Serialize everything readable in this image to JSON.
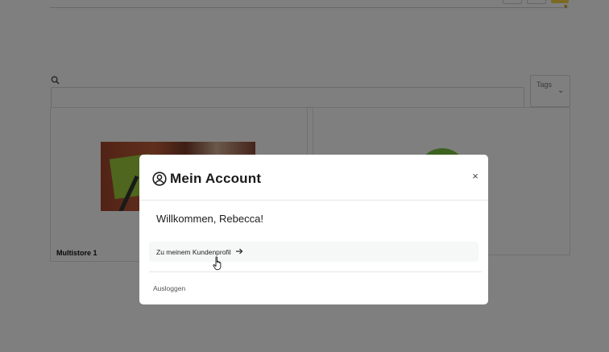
{
  "background": {
    "tags_label": "Tags",
    "cards": [
      {
        "title": "Multistore 1"
      },
      {
        "title": ""
      }
    ]
  },
  "modal": {
    "title": "Mein Account",
    "close_label": "×",
    "welcome": "Willkommen, Rebecca!",
    "profile_link_label": "Zu meinem Kundenprofil",
    "logout_label": "Ausloggen"
  },
  "icons": {
    "account": "user-circle-icon",
    "close": "close-icon",
    "arrow": "arrow-right-icon",
    "search": "search-icon",
    "cursor": "hand-pointer-icon"
  },
  "colors": {
    "overlay": "rgba(0,0,0,0.5)",
    "modal_bg": "#ffffff",
    "accent_yellow": "#f5d547",
    "accent_green": "#7cc243"
  }
}
